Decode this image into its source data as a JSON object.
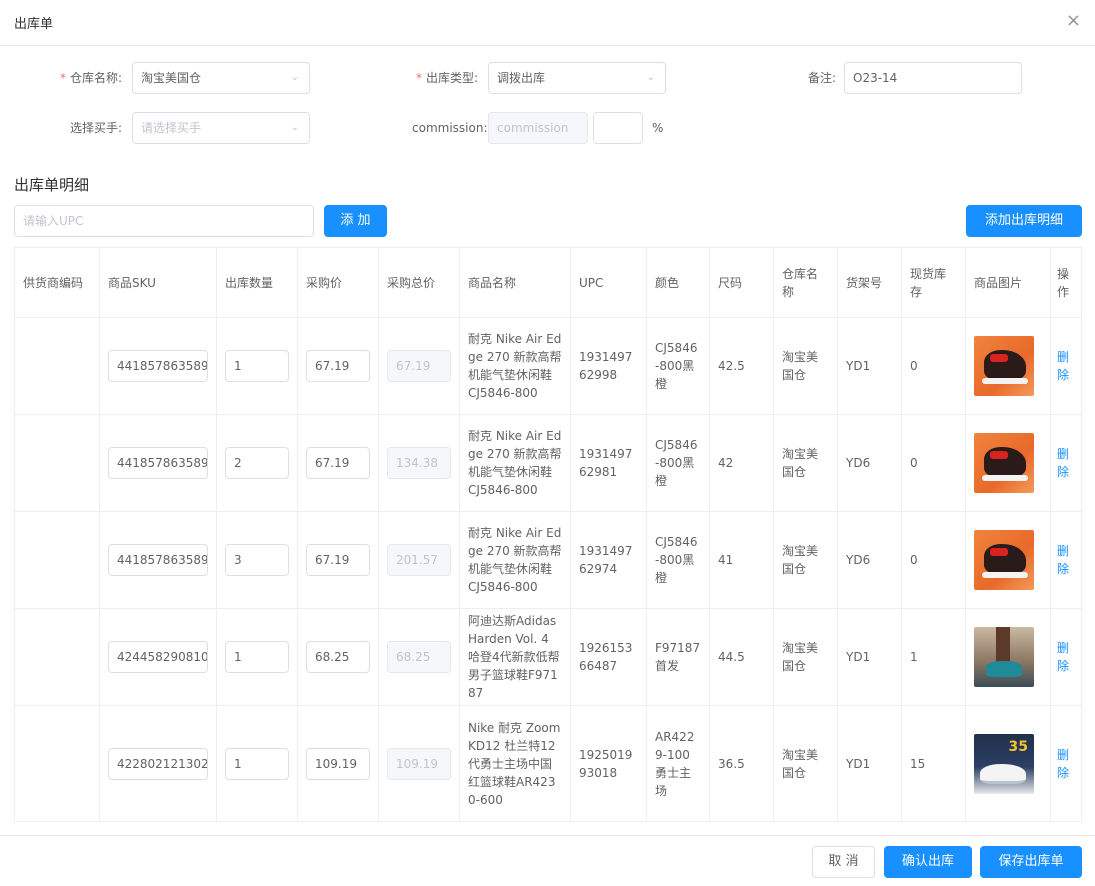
{
  "dialog": {
    "title": "出库单",
    "close_icon": "×"
  },
  "form": {
    "warehouse": {
      "label": "仓库名称:",
      "value": "淘宝美国仓",
      "required": true
    },
    "outbound_type": {
      "label": "出库类型:",
      "value": "调拨出库",
      "required": true
    },
    "remark": {
      "label": "备注:",
      "value": "O23-14"
    },
    "buyer": {
      "label": "选择买手:",
      "placeholder": "请选择买手"
    },
    "commission": {
      "label": "commission:",
      "placeholder": "commission",
      "value": "",
      "unit": "%"
    }
  },
  "details": {
    "section_title": "出库单明细",
    "upc_placeholder": "请输入UPC",
    "add_button": "添 加",
    "add_detail_button": "添加出库明细"
  },
  "table": {
    "headers": [
      "供货商编码",
      "商品SKU",
      "出库数量",
      "采购价",
      "采购总价",
      "商品名称",
      "UPC",
      "颜色",
      "尺码",
      "仓库名称",
      "货架号",
      "现货库存",
      "商品图片",
      "操作"
    ],
    "rows": [
      {
        "supplier_code": "",
        "sku": "441857863589",
        "qty": "1",
        "price": "67.19",
        "total": "67.19",
        "name": "耐克 Nike Air Edge 270 新款高帮机能气垫休闲鞋 CJ5846-800",
        "upc": "193149762998",
        "color": "CJ5846-800黑橙",
        "size": "42.5",
        "warehouse": "淘宝美国仓",
        "shelf": "YD1",
        "stock": "0",
        "image": "shoe-orange",
        "action": "删除"
      },
      {
        "supplier_code": "",
        "sku": "441857863589",
        "qty": "2",
        "price": "67.19",
        "total": "134.38",
        "name": "耐克 Nike Air Edge 270 新款高帮机能气垫休闲鞋 CJ5846-800",
        "upc": "193149762981",
        "color": "CJ5846-800黑橙",
        "size": "42",
        "warehouse": "淘宝美国仓",
        "shelf": "YD6",
        "stock": "0",
        "image": "shoe-orange",
        "action": "删除"
      },
      {
        "supplier_code": "",
        "sku": "441857863589",
        "qty": "3",
        "price": "67.19",
        "total": "201.57",
        "name": "耐克 Nike Air Edge 270 新款高帮机能气垫休闲鞋 CJ5846-800",
        "upc": "193149762974",
        "color": "CJ5846-800黑橙",
        "size": "41",
        "warehouse": "淘宝美国仓",
        "shelf": "YD6",
        "stock": "0",
        "image": "shoe-orange",
        "action": "删除"
      },
      {
        "supplier_code": "",
        "sku": "424458290810",
        "qty": "1",
        "price": "68.25",
        "total": "68.25",
        "name": "阿迪达斯Adidas Harden Vol. 4 哈登4代新款低帮男子篮球鞋F97187",
        "upc": "192615366487",
        "color": "F97187首发",
        "size": "44.5",
        "warehouse": "淘宝美国仓",
        "shelf": "YD1",
        "stock": "1",
        "image": "shoe-court",
        "action": "删除"
      },
      {
        "supplier_code": "",
        "sku": "422802121302",
        "qty": "1",
        "price": "109.19",
        "total": "109.19",
        "name": "Nike 耐克 Zoom KD12 杜兰特12代勇士主场中国红篮球鞋AR4230-600",
        "upc": "192501993018",
        "color": "AR4229-100勇士主场",
        "size": "36.5",
        "warehouse": "淘宝美国仓",
        "shelf": "YD1",
        "stock": "15",
        "image": "shoe-kd",
        "kd_badge": "35",
        "action": "删除"
      }
    ]
  },
  "footer": {
    "cancel": "取 消",
    "confirm": "确认出库",
    "save": "保存出库单"
  }
}
